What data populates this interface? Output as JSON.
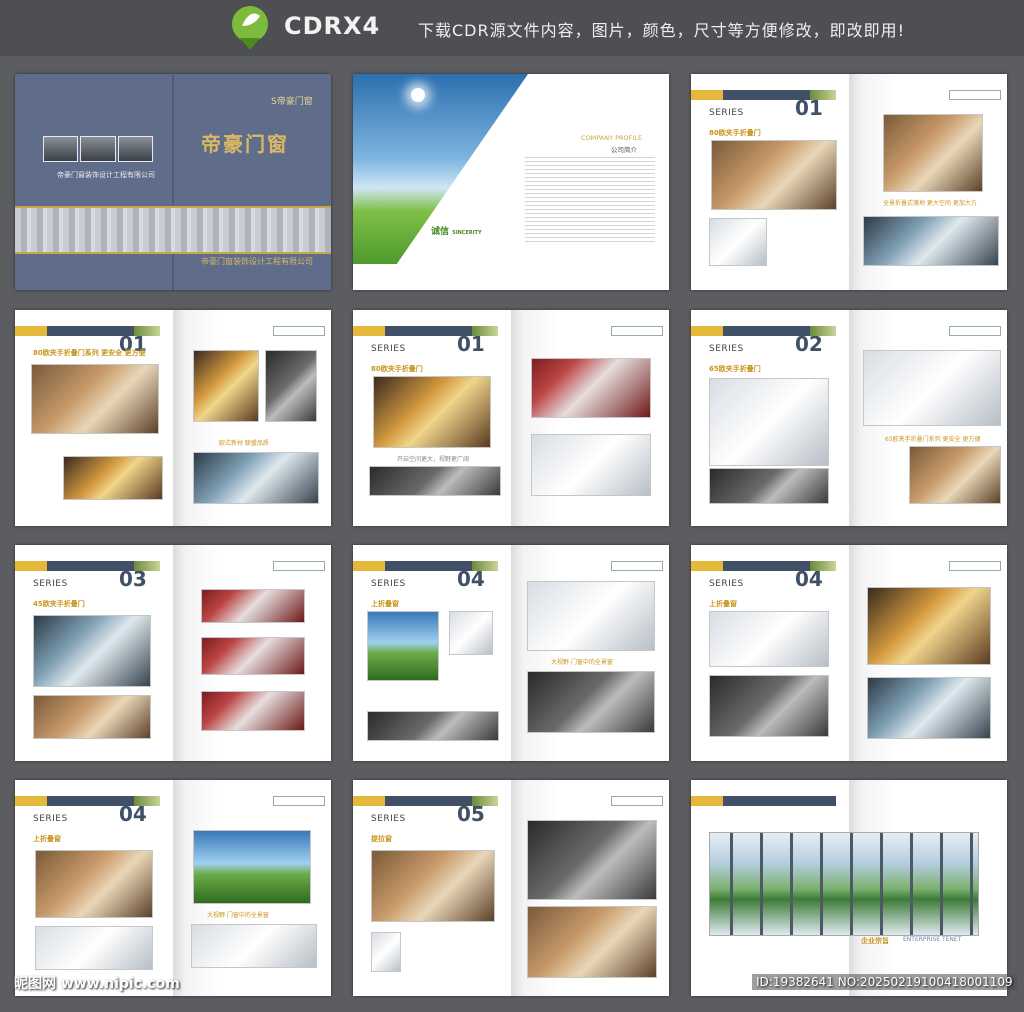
{
  "header": {
    "brand": "CDRX4",
    "slogan": "下载CDR源文件内容，图片，颜色，尺寸等方便修改，即改即用!",
    "logo_icon": "pen-nib-leaf-icon"
  },
  "cover": {
    "title": "帝豪门窗",
    "company_small": "帝豪门窗装饰设计工程有限公司",
    "company_bottom": "帝豪门窗装饰设计工程有限公司",
    "logo_text": "S帝豪门窗"
  },
  "company_profile": {
    "heading": "COMPANY PROFILE",
    "heading_cn": "公司简介",
    "sincerity": "诚信",
    "sincerity_en": "SINCERITY"
  },
  "pages": [
    {
      "series": "SERIES",
      "sub": "80欧夹手折叠门",
      "num": "01",
      "caption": "全景折叠式落地  更大空间  更加大方"
    },
    {
      "series": "",
      "sub": "80欧夹手折叠门系列  更安全  更方便",
      "num": "01",
      "caption": "欧式新材  联盟品质"
    },
    {
      "series": "SERIES",
      "sub": "80欧夹手折叠门",
      "num": "01",
      "caption": "开启空间更大，视野更广阔"
    },
    {
      "series": "SERIES",
      "sub": "65欧夹手折叠门",
      "num": "02",
      "caption": "65欧夹手折叠门系列  更安全  更方便"
    },
    {
      "series": "SERIES",
      "sub": "45欧夹手折叠门",
      "num": "03",
      "caption": ""
    },
    {
      "series": "SERIES",
      "sub": "上折叠窗",
      "num": "04",
      "caption": "大视野  门窗中的全景窗"
    },
    {
      "series": "SERIES",
      "sub": "上折叠窗",
      "num": "04",
      "caption": ""
    },
    {
      "series": "SERIES",
      "sub": "上折叠窗",
      "num": "04",
      "caption": "大视野  门窗中的全景窗"
    },
    {
      "series": "SERIES",
      "sub": "提拉窗",
      "num": "05",
      "caption": ""
    }
  ],
  "enterprise": {
    "title": "企业宗旨",
    "title_en": "ENTERPRISE TENET"
  },
  "footer": {
    "watermark": "昵图网 www.nipic.com",
    "image_id": "ID:19382641 NO:20250219100418001109"
  },
  "colors": {
    "navy": "#3f5067",
    "gold": "#c9951f",
    "yellow": "#e4b83a",
    "cover_blue": "#5f6d8a"
  }
}
